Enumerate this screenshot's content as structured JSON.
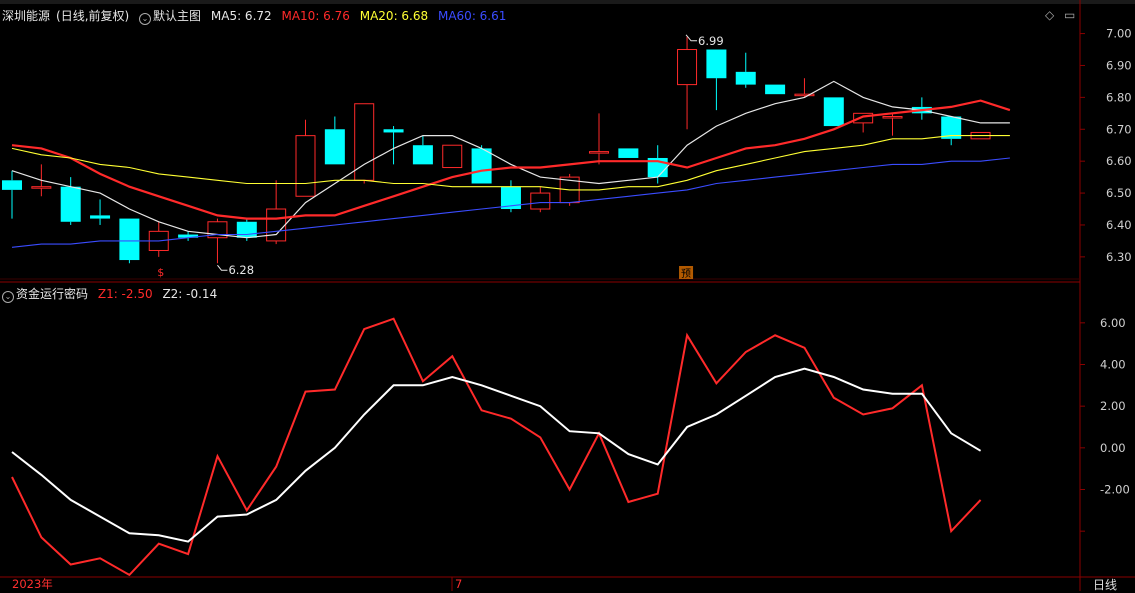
{
  "window": {
    "stock_title": "深圳能源",
    "mode": "(日线,前复权)",
    "template": "默认主图",
    "period": "日线"
  },
  "main_legend": {
    "ma5": "MA5: 6.72",
    "ma10": "MA10: 6.76",
    "ma20": "MA20: 6.68",
    "ma60": "MA60: 6.61"
  },
  "indicator_legend": {
    "name": "资金运行密码",
    "z1": "Z1: -2.50",
    "z2": "Z2: -0.14"
  },
  "icons": {
    "diamond": "diamond-icon",
    "expand": "expand-icon",
    "collapse": "collapse-icon"
  },
  "colors": {
    "up": "#ff2a2a",
    "down": "#00ffff",
    "ma5": "#e6e6e6",
    "ma10": "#ff2a2a",
    "ma20": "#ffff33",
    "ma60": "#3a4cff"
  },
  "chart_data": [
    {
      "type": "candlestick",
      "title": "深圳能源",
      "ylim": [
        6.24,
        7.03
      ],
      "y_ticks": [
        "7.00",
        "6.90",
        "6.80",
        "6.70",
        "6.60",
        "6.50",
        "6.40",
        "6.30"
      ],
      "x_labels": [
        "2023年",
        "7"
      ],
      "candles": [
        [
          6.54,
          6.57,
          6.42,
          6.51
        ],
        [
          6.52,
          6.59,
          6.49,
          6.52
        ],
        [
          6.52,
          6.55,
          6.4,
          6.41
        ],
        [
          6.43,
          6.48,
          6.4,
          6.42
        ],
        [
          6.42,
          6.42,
          6.28,
          6.29
        ],
        [
          6.32,
          6.41,
          6.3,
          6.38
        ],
        [
          6.37,
          6.38,
          6.35,
          6.36
        ],
        [
          6.36,
          6.42,
          6.28,
          6.41
        ],
        [
          6.41,
          6.42,
          6.35,
          6.36
        ],
        [
          6.35,
          6.54,
          6.34,
          6.45
        ],
        [
          6.49,
          6.73,
          6.49,
          6.68
        ],
        [
          6.7,
          6.74,
          6.59,
          6.59
        ],
        [
          6.54,
          6.78,
          6.53,
          6.78
        ],
        [
          6.7,
          6.71,
          6.59,
          6.69
        ],
        [
          6.65,
          6.68,
          6.59,
          6.59
        ],
        [
          6.58,
          6.65,
          6.58,
          6.65
        ],
        [
          6.64,
          6.65,
          6.53,
          6.53
        ],
        [
          6.52,
          6.54,
          6.44,
          6.45
        ],
        [
          6.45,
          6.52,
          6.44,
          6.5
        ],
        [
          6.47,
          6.56,
          6.46,
          6.55
        ],
        [
          6.63,
          6.75,
          6.59,
          6.63
        ],
        [
          6.64,
          6.64,
          6.61,
          6.61
        ],
        [
          6.61,
          6.65,
          6.53,
          6.55
        ],
        [
          6.84,
          6.99,
          6.7,
          6.95
        ],
        [
          6.95,
          6.95,
          6.76,
          6.86
        ],
        [
          6.88,
          6.94,
          6.83,
          6.84
        ],
        [
          6.84,
          6.84,
          6.81,
          6.81
        ],
        [
          6.81,
          6.86,
          6.8,
          6.81
        ],
        [
          6.8,
          6.8,
          6.71,
          6.71
        ],
        [
          6.72,
          6.75,
          6.69,
          6.75
        ],
        [
          6.74,
          6.75,
          6.68,
          6.74
        ],
        [
          6.77,
          6.8,
          6.73,
          6.75
        ],
        [
          6.74,
          6.74,
          6.65,
          6.67
        ],
        [
          6.67,
          6.69,
          6.67,
          6.69
        ]
      ],
      "series": [
        {
          "name": "MA5",
          "values": [
            6.57,
            6.54,
            6.52,
            6.5,
            6.45,
            6.41,
            6.38,
            6.37,
            6.36,
            6.37,
            6.47,
            6.53,
            6.59,
            6.64,
            6.68,
            6.68,
            6.64,
            6.59,
            6.55,
            6.54,
            6.53,
            6.54,
            6.55,
            6.65,
            6.71,
            6.75,
            6.78,
            6.8,
            6.85,
            6.8,
            6.77,
            6.76,
            6.74,
            6.72,
            6.72
          ]
        },
        {
          "name": "MA10",
          "values": [
            6.65,
            6.64,
            6.61,
            6.56,
            6.52,
            6.49,
            6.46,
            6.43,
            6.42,
            6.42,
            6.43,
            6.43,
            6.46,
            6.49,
            6.52,
            6.55,
            6.57,
            6.58,
            6.58,
            6.59,
            6.6,
            6.6,
            6.6,
            6.58,
            6.61,
            6.64,
            6.65,
            6.67,
            6.7,
            6.74,
            6.75,
            6.76,
            6.77,
            6.79,
            6.76
          ]
        },
        {
          "name": "MA20",
          "values": [
            6.64,
            6.62,
            6.61,
            6.59,
            6.58,
            6.56,
            6.55,
            6.54,
            6.53,
            6.53,
            6.53,
            6.54,
            6.54,
            6.53,
            6.53,
            6.52,
            6.52,
            6.52,
            6.52,
            6.51,
            6.51,
            6.52,
            6.52,
            6.54,
            6.57,
            6.59,
            6.61,
            6.63,
            6.64,
            6.65,
            6.67,
            6.67,
            6.68,
            6.68,
            6.68
          ]
        },
        {
          "name": "MA60",
          "values": [
            6.33,
            6.34,
            6.34,
            6.35,
            6.35,
            6.35,
            6.36,
            6.37,
            6.37,
            6.38,
            6.39,
            6.4,
            6.41,
            6.42,
            6.43,
            6.44,
            6.45,
            6.46,
            6.47,
            6.47,
            6.48,
            6.49,
            6.5,
            6.51,
            6.53,
            6.54,
            6.55,
            6.56,
            6.57,
            6.58,
            6.59,
            6.59,
            6.6,
            6.6,
            6.61
          ]
        }
      ],
      "annotations": [
        {
          "label": "6.99",
          "index": 23,
          "value": 6.99
        },
        {
          "label": "6.28",
          "index": 7,
          "value": 6.28
        },
        {
          "label": "$",
          "index": 5
        },
        {
          "label": "预",
          "index": 23
        }
      ]
    },
    {
      "type": "line",
      "title": "资金运行密码",
      "ylim": [
        -6.2,
        7.0
      ],
      "y_ticks": [
        "6.00",
        "4.00",
        "2.00",
        "0.00",
        "-2.00"
      ],
      "series": [
        {
          "name": "Z1",
          "values": [
            -1.4,
            -4.3,
            -5.6,
            -5.3,
            -6.1,
            -4.6,
            -5.1,
            -0.4,
            -3.0,
            -0.9,
            2.7,
            2.8,
            5.7,
            6.2,
            3.2,
            4.4,
            1.8,
            1.4,
            0.5,
            -2.0,
            0.7,
            -2.6,
            -2.2,
            5.4,
            3.1,
            4.6,
            5.4,
            4.8,
            2.4,
            1.6,
            1.9,
            3.0,
            -4.0,
            -2.5
          ]
        },
        {
          "name": "Z2",
          "values": [
            -0.2,
            -1.3,
            -2.5,
            -3.3,
            -4.1,
            -4.2,
            -4.5,
            -3.3,
            -3.2,
            -2.5,
            -1.1,
            0.0,
            1.6,
            3.0,
            3.0,
            3.4,
            3.0,
            2.5,
            2.0,
            0.8,
            0.7,
            -0.3,
            -0.8,
            1.0,
            1.6,
            2.5,
            3.4,
            3.8,
            3.4,
            2.8,
            2.6,
            2.6,
            0.7,
            -0.14
          ]
        }
      ]
    }
  ]
}
